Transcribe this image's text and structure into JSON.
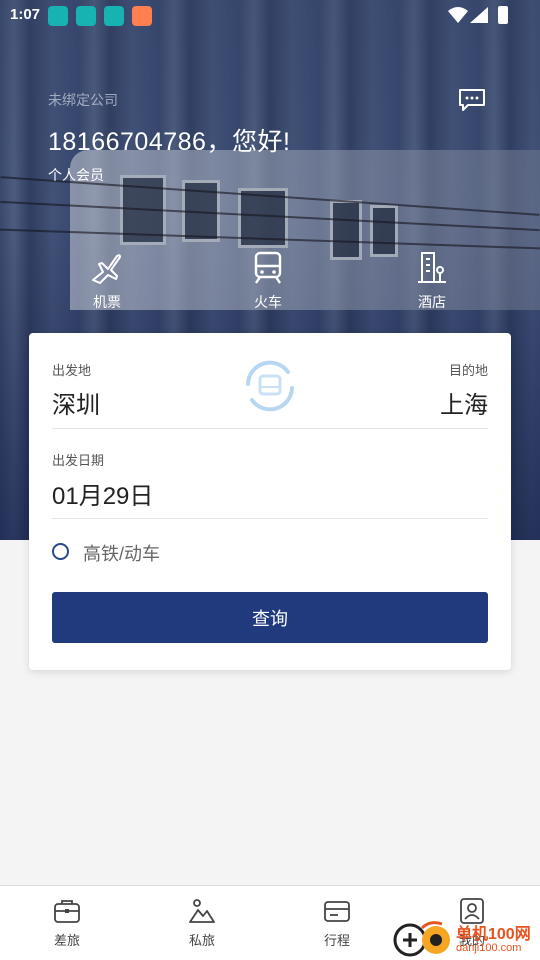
{
  "status_bar": {
    "time": "1:07"
  },
  "header": {
    "company": "未绑定公司",
    "greeting": "18166704786，您好!",
    "member_level": "个人会员"
  },
  "modes": [
    {
      "label": "机票",
      "icon": "plane-icon"
    },
    {
      "label": "火车",
      "icon": "train-icon"
    },
    {
      "label": "酒店",
      "icon": "hotel-icon"
    }
  ],
  "search": {
    "from_label": "出发地",
    "from_city": "深圳",
    "to_label": "目的地",
    "to_city": "上海",
    "date_label": "出发日期",
    "date": "01月29日",
    "high_speed_option": "高铁/动车",
    "query_button": "查询"
  },
  "tabs": [
    {
      "label": "差旅",
      "icon": "briefcase-icon"
    },
    {
      "label": "私旅",
      "icon": "mountain-icon"
    },
    {
      "label": "行程",
      "icon": "ticket-icon"
    },
    {
      "label": "我的",
      "icon": "profile-icon"
    }
  ],
  "watermark": {
    "title": "单机100网",
    "url": "danji100.com"
  },
  "colors": {
    "primary": "#213a7e",
    "accent": "#2a4a8c",
    "watermark": "#e8531f"
  }
}
